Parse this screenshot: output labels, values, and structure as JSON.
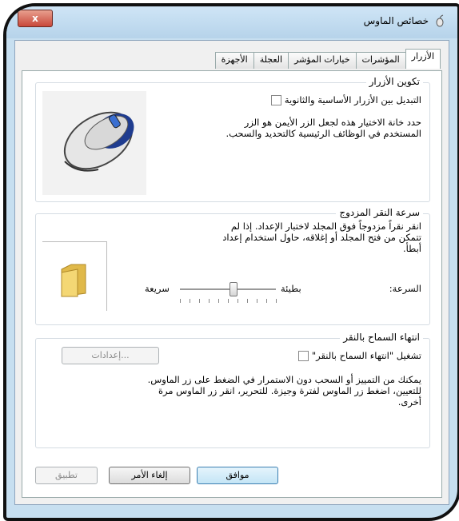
{
  "window": {
    "title": "خصائص الماوس",
    "close_label": "x"
  },
  "tabs": [
    "الأزرار",
    "المؤشرات",
    "خيارات المؤشر",
    "العجلة",
    "الأجهزة"
  ],
  "button_config": {
    "title": "تكوين الأزرار",
    "checkbox_label": "التبديل بين الأزرار الأساسية والثانوية",
    "description_line1": "حدد خانة الاختيار هذه لجعل الزر الأيمن هو الزر",
    "description_line2": "المستخدم في الوظائف الرئيسية كالتحديد والسحب."
  },
  "double_click": {
    "title": "سرعة النقر المزدوج",
    "description_line1": "انقر نقراً مزدوجاً فوق المجلد لاختبار الإعداد. إذا لم",
    "description_line2": "تتمكن من فتح المجلد أو إغلاقه، حاول استخدام إعداد",
    "description_line3": "أبطأ.",
    "speed_label": "السرعة:",
    "slow_label": "بطيئة",
    "fast_label": "سريعة",
    "speed_level": 0.45
  },
  "click_lock": {
    "title": "انتهاء السماح بالنقر",
    "checkbox_label": "تشغيل \"انتهاء السماح بالنقر\"",
    "settings_button": "إعدادات...",
    "description_line1": "يمكنك من التمييز أو السحب دون الاستمرار في الضغط على زر الماوس.",
    "description_line2": "للتعيين، اضغط زر الماوس لفترة وجيزة. للتحرير، انقر زر الماوس مرة",
    "description_line3": "أخرى."
  },
  "footer": {
    "ok": "موافق",
    "cancel": "إلغاء الأمر",
    "apply": "تطبيق"
  }
}
